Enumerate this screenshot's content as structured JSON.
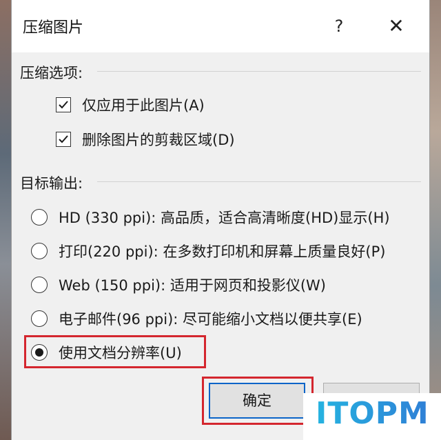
{
  "dialog": {
    "title": "压缩图片",
    "help_label": "?",
    "close_label": "✕"
  },
  "compress_options": {
    "label": "压缩选项:",
    "apply_only_this": {
      "label": "仅应用于此图片(A)",
      "checked": true
    },
    "delete_cropped": {
      "label": "删除图片的剪裁区域(D)",
      "checked": true
    }
  },
  "target_output": {
    "label": "目标输出:",
    "options": [
      {
        "label": "HD (330 ppi): 高品质，适合高清晰度(HD)显示(H)",
        "selected": false
      },
      {
        "label": "打印(220 ppi): 在多数打印机和屏幕上质量良好(P)",
        "selected": false
      },
      {
        "label": "Web (150 ppi): 适用于网页和投影仪(W)",
        "selected": false
      },
      {
        "label": "电子邮件(96 ppi): 尽可能缩小文档以便共享(E)",
        "selected": false
      },
      {
        "label": "使用文档分辨率(U)",
        "selected": true
      }
    ]
  },
  "buttons": {
    "ok_label": "确定"
  },
  "watermark": {
    "text": "ITOPM"
  },
  "colors": {
    "highlight": "#d4262e",
    "accent": "#0a64c8"
  }
}
